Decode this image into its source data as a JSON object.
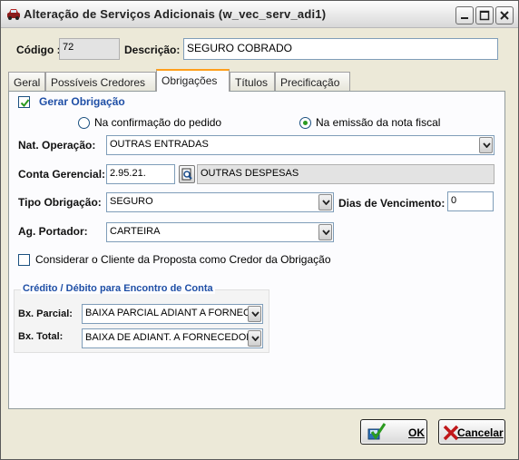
{
  "window": {
    "title": "Alteração de Serviços Adicionais (w_vec_serv_adi1)"
  },
  "header": {
    "codigo_label": "Código :",
    "codigo_value": "72",
    "descricao_label": "Descrição:",
    "descricao_value": "SEGURO COBRADO"
  },
  "tabs": [
    {
      "label": "Geral",
      "active": false
    },
    {
      "label": "Possíveis Credores",
      "active": false
    },
    {
      "label": "Obrigações",
      "active": true
    },
    {
      "label": "Títulos",
      "active": false
    },
    {
      "label": "Precificação",
      "active": false
    }
  ],
  "form": {
    "gerar_obrigacao_label": "Gerar Obrigação",
    "gerar_obrigacao_checked": true,
    "radio_pedido_label": "Na confirmação do pedido",
    "radio_nota_label": "Na emissão da nota fiscal",
    "radio_selected": "nota",
    "nat_operacao_label": "Nat. Operação:",
    "nat_operacao_value": "OUTRAS ENTRADAS",
    "conta_gerencial_label": "Conta Gerencial:",
    "conta_gerencial_code": "2.95.21.",
    "conta_gerencial_desc": "OUTRAS DESPESAS",
    "tipo_obrigacao_label": "Tipo Obrigação:",
    "tipo_obrigacao_value": "SEGURO",
    "dias_vencimento_label": "Dias de Vencimento:",
    "dias_vencimento_value": "0",
    "ag_portador_label": "Ag. Portador:",
    "ag_portador_value": "CARTEIRA",
    "considerar_cliente_label": "Considerar o Cliente da Proposta como Credor da Obrigação",
    "considerar_cliente_checked": false
  },
  "group": {
    "title": "Crédito / Débito para Encontro de Conta",
    "bx_parcial_label": "Bx. Parcial:",
    "bx_parcial_value": "BAIXA PARCIAL ADIANT A FORNEC",
    "bx_total_label": "Bx. Total:",
    "bx_total_value": "BAIXA DE ADIANT. A FORNECEDOR"
  },
  "buttons": {
    "ok_label": "OK",
    "cancel_label": "Cancelar"
  },
  "colors": {
    "accent_blue": "#1f4fa6",
    "tab_active_highlight": "#ff9f1c",
    "check_green": "#2b9a1f"
  }
}
